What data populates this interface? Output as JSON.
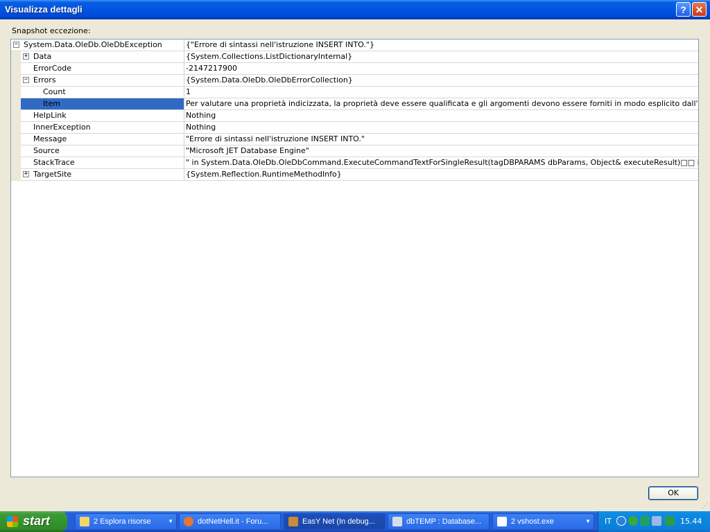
{
  "window": {
    "title": "Visualizza dettagli",
    "help_label": "?",
    "close_label": "✕"
  },
  "snapshot_label": "Snapshot eccezione:",
  "rows": [
    {
      "name": "System.Data.OleDb.OleDbException",
      "value": "{\"Errore di sintassi nell'istruzione INSERT INTO.\"}",
      "expander": "−"
    },
    {
      "name": "Data",
      "value": "{System.Collections.ListDictionaryInternal}",
      "expander": "+"
    },
    {
      "name": "ErrorCode",
      "value": "-2147217900"
    },
    {
      "name": "Errors",
      "value": "{System.Data.OleDb.OleDbErrorCollection}",
      "expander": "−"
    },
    {
      "name": "Count",
      "value": "1"
    },
    {
      "name": "Item",
      "value": "Per valutare una proprietà indicizzata, la proprietà deve essere qualificata e gli argomenti devono essere forniti in modo esplicito dall'utente."
    },
    {
      "name": "HelpLink",
      "value": "Nothing"
    },
    {
      "name": "InnerException",
      "value": "Nothing"
    },
    {
      "name": "Message",
      "value": "\"Errore di sintassi nell'istruzione INSERT INTO.\""
    },
    {
      "name": "Source",
      "value": "\"Microsoft JET Database Engine\""
    },
    {
      "name": "StackTrace",
      "value": "\"   in System.Data.OleDb.OleDbCommand.ExecuteCommandTextForSingleResult(tagDBPARAMS dbParams, Object& executeResult)□□   in System.Data."
    },
    {
      "name": "TargetSite",
      "value": "{System.Reflection.RuntimeMethodInfo}",
      "expander": "+"
    }
  ],
  "ok_label": "OK",
  "taskbar": {
    "start_label": "start",
    "tasks": [
      {
        "label": "2 Esplora risorse",
        "arrow": "▼"
      },
      {
        "label": "dotNetHell.it - Foru..."
      },
      {
        "label": "EasY Net (In debug..."
      },
      {
        "label": "dbTEMP : Database..."
      },
      {
        "label": "2 vshost.exe",
        "arrow": "▼"
      }
    ],
    "lang": "IT",
    "clock": "15.44"
  },
  "colors": {
    "selection": "#316ac5",
    "titlebar": "#0054e3",
    "start": "#3c9b35"
  }
}
